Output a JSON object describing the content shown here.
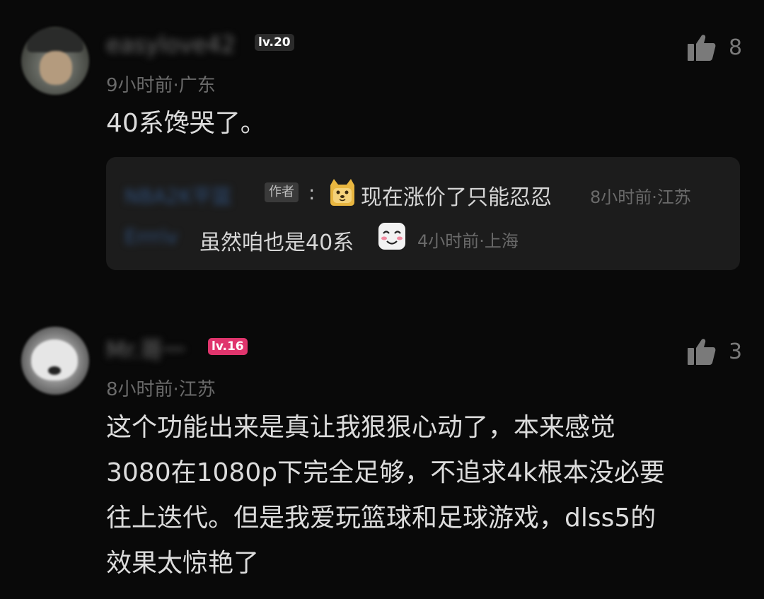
{
  "comments": [
    {
      "username": "easylove42",
      "level": "lv.20",
      "meta": "9小时前·广东",
      "text": "40系馋哭了。",
      "likes": "8",
      "replies": [
        {
          "name": "NBA2K平篮",
          "author_tag": "作者",
          "colon": ":",
          "emoji": "dog-face-emoji",
          "text": "现在涨价了只能忍忍",
          "meta": "8小时前·江苏"
        },
        {
          "name": "Errriv",
          "text": "虽然咱也是40系",
          "emoji": "blush-smile-emoji",
          "meta": "4小时前·上海"
        }
      ]
    },
    {
      "username": "Mr.哥一",
      "level": "lv.16",
      "meta": "8小时前·江苏",
      "text_lines": [
        "这个功能出来是真让我狠狠心动了，本来感觉",
        "3080在1080p下完全足够，不追求4k根本没必要",
        "往上迭代。但是我爱玩篮球和足球游戏，dlss5的",
        "效果太惊艳了"
      ],
      "likes": "3"
    }
  ],
  "colors": {
    "background": "#090909",
    "reply_background": "#1c1c1c",
    "level16_badge": "#e0356d",
    "level20_badge": "#2b2b2b",
    "reply_name": "#2f4f7a"
  }
}
